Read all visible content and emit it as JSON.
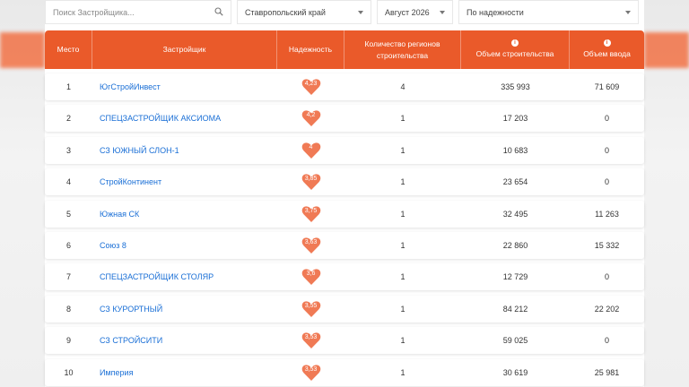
{
  "filters": {
    "search_placeholder": "Поиск Застройщика...",
    "region": "Ставропольский край",
    "date": "Август 2026",
    "sort": "По надежности"
  },
  "table": {
    "headers": {
      "place": "Место",
      "developer": "Застройщик",
      "reliability": "Надежность",
      "regions": "Количество регионов строительства",
      "construction_volume": "Объем строительства",
      "commissioning_volume": "Объем ввода"
    },
    "rows": [
      {
        "place": "1",
        "name": "ЮгСтройИнвест",
        "rating": "4,23",
        "regions": "4",
        "volume": "335 993",
        "commissioning": "71 609"
      },
      {
        "place": "2",
        "name": "СПЕЦЗАСТРОЙЩИК АКСИОМА",
        "rating": "4,2",
        "regions": "1",
        "volume": "17 203",
        "commissioning": "0"
      },
      {
        "place": "3",
        "name": "СЗ ЮЖНЫЙ СЛОН-1",
        "rating": "4",
        "regions": "1",
        "volume": "10 683",
        "commissioning": "0"
      },
      {
        "place": "4",
        "name": "СтройКонтинент",
        "rating": "3,85",
        "regions": "1",
        "volume": "23 654",
        "commissioning": "0"
      },
      {
        "place": "5",
        "name": "Южная СК",
        "rating": "3,75",
        "regions": "1",
        "volume": "32 495",
        "commissioning": "11 263"
      },
      {
        "place": "6",
        "name": "Союз 8",
        "rating": "3,63",
        "regions": "1",
        "volume": "22 860",
        "commissioning": "15 332"
      },
      {
        "place": "7",
        "name": "СПЕЦЗАСТРОЙЩИК СТОЛЯР",
        "rating": "3,6",
        "regions": "1",
        "volume": "12 729",
        "commissioning": "0"
      },
      {
        "place": "8",
        "name": "СЗ КУРОРТНЫЙ",
        "rating": "3,55",
        "regions": "1",
        "volume": "84 212",
        "commissioning": "22 202"
      },
      {
        "place": "9",
        "name": "СЗ СТРОЙСИТИ",
        "rating": "3,53",
        "regions": "1",
        "volume": "59 025",
        "commissioning": "0"
      },
      {
        "place": "10",
        "name": "Империя",
        "rating": "3,53",
        "regions": "1",
        "volume": "30 619",
        "commissioning": "25 981"
      }
    ]
  },
  "colors": {
    "accent": "#ea5a2a",
    "link": "#1a6fd6",
    "heart": "#f07a55"
  }
}
